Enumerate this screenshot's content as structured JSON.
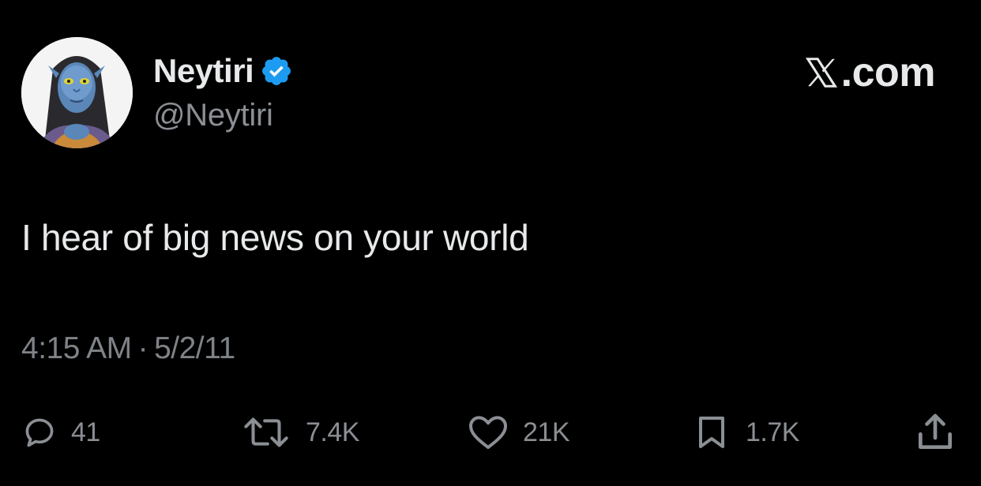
{
  "author": {
    "display_name": "Neytiri",
    "handle": "@Neytiri",
    "verified": true,
    "badge_color": "#1d9bf0",
    "avatar_icon": "avatar-photo"
  },
  "brand": {
    "label": ".com",
    "icon": "x-logo-icon"
  },
  "tweet": {
    "text": "I hear of big news on your world",
    "time": "4:15 AM",
    "separator": "·",
    "date": "5/2/11"
  },
  "actions": {
    "reply": {
      "icon": "reply-icon",
      "count": "41"
    },
    "retweet": {
      "icon": "retweet-icon",
      "count": "7.4K"
    },
    "like": {
      "icon": "heart-icon",
      "count": "21K"
    },
    "bookmark": {
      "icon": "bookmark-icon",
      "count": "1.7K"
    },
    "share": {
      "icon": "share-icon"
    }
  },
  "colors": {
    "background": "#000000",
    "primary_text": "#e7e9ea",
    "secondary_text": "#8b8f94"
  }
}
